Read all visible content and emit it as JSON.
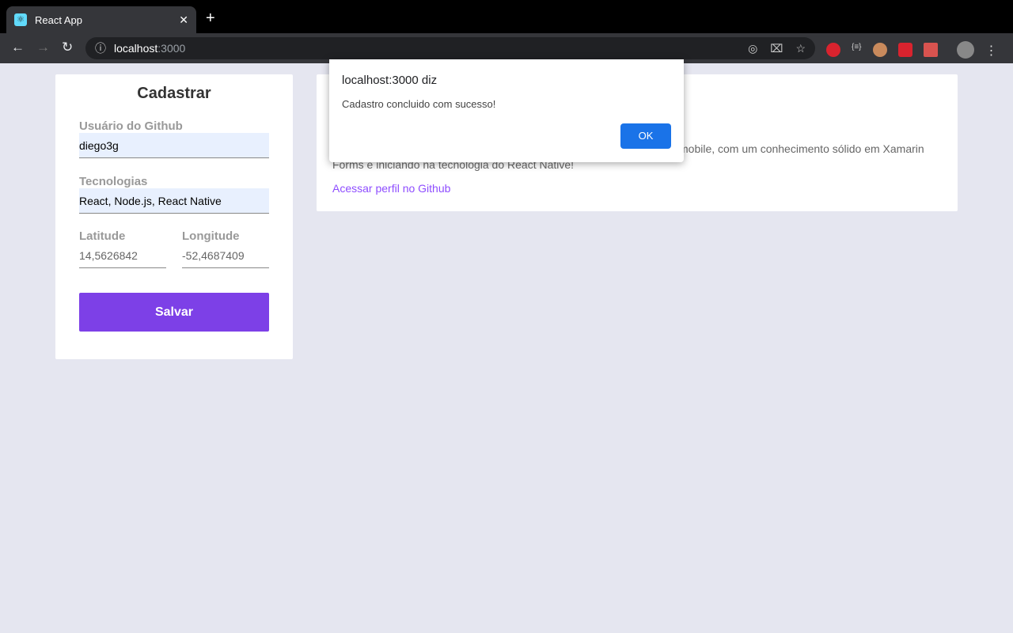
{
  "browser": {
    "tab_title": "React App",
    "url_host": "localhost",
    "url_port": ":3000"
  },
  "form": {
    "title": "Cadastrar",
    "github_label": "Usuário do Github",
    "github_value": "diego3g",
    "techs_label": "Tecnologias",
    "techs_value": "React, Node.js, React Native",
    "lat_label": "Latitude",
    "lat_value": "14,5626842",
    "lng_label": "Longitude",
    "lng_value": "-52,4687409",
    "submit": "Salvar"
  },
  "dev": {
    "bio_line1_visible": "mobile, com um conhecimento sólido em Xamarin",
    "bio_line2": "Forms e iniciando na tecnologia do React Native!",
    "link": "Acessar perfil no Github",
    "accent": "#7d40e7"
  },
  "dialog": {
    "title": "localhost:3000 diz",
    "message": "Cadastro concluido com sucesso!",
    "ok": "OK",
    "ok_color": "#1a73e8"
  }
}
